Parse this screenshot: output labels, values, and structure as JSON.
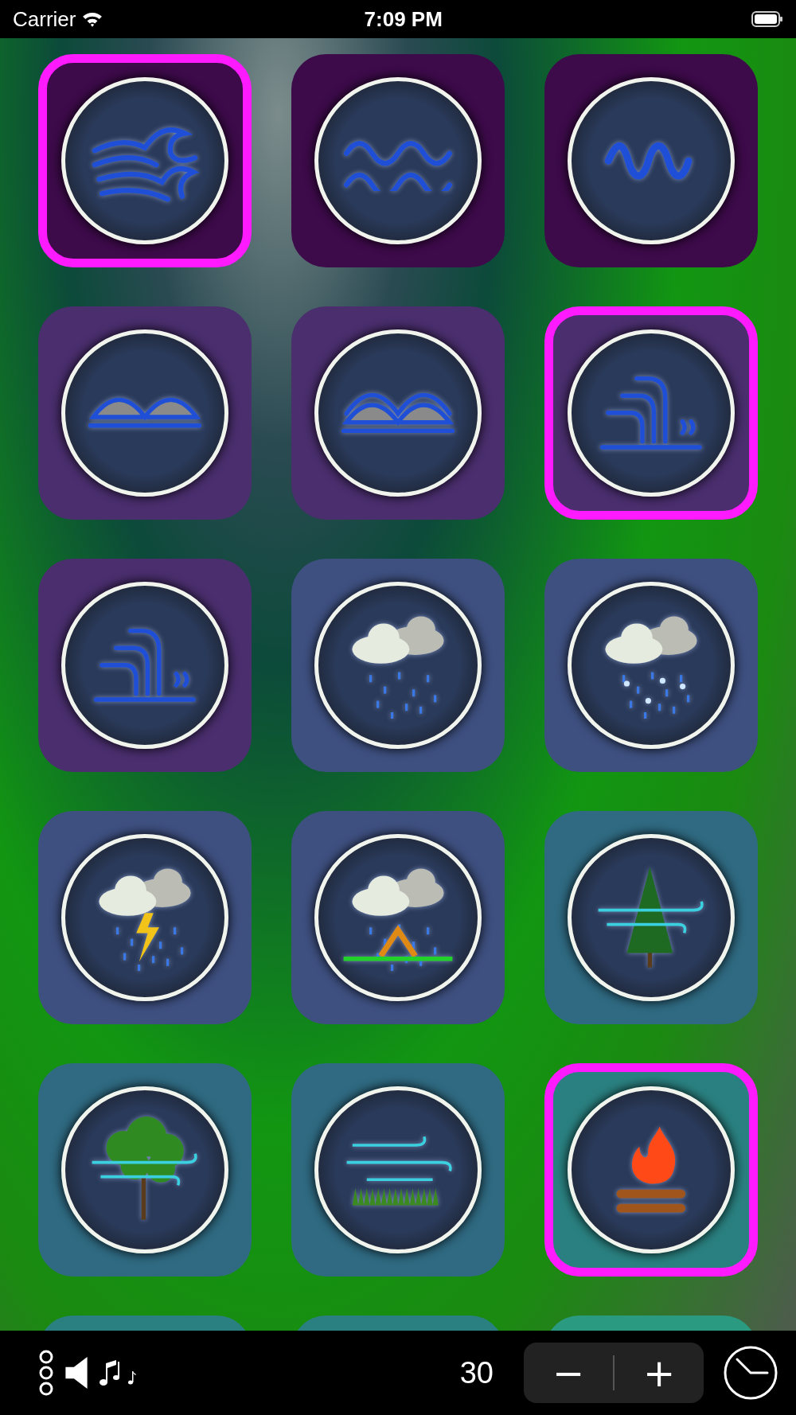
{
  "status_bar": {
    "carrier": "Carrier",
    "time": "7:09 PM"
  },
  "tiles": [
    {
      "selected": true,
      "color": "#3d0a4a"
    },
    {
      "selected": false,
      "color": "#3d0a4a"
    },
    {
      "selected": false,
      "color": "#3d0a4a"
    },
    {
      "selected": false,
      "color": "#4a2e6e"
    },
    {
      "selected": false,
      "color": "#4a2e6e"
    },
    {
      "selected": true,
      "color": "#4a2e6e"
    },
    {
      "selected": false,
      "color": "#4a2e6e"
    },
    {
      "selected": false,
      "color": "#3e5080"
    },
    {
      "selected": false,
      "color": "#3e5080"
    },
    {
      "selected": false,
      "color": "#3e5080"
    },
    {
      "selected": false,
      "color": "#3e5080"
    },
    {
      "selected": false,
      "color": "#2f6a82"
    },
    {
      "selected": false,
      "color": "#2f6a82"
    },
    {
      "selected": false,
      "color": "#2f6a82"
    },
    {
      "selected": true,
      "color": "#2a8080"
    },
    {
      "selected": false,
      "color": "#2a8080"
    },
    {
      "selected": false,
      "color": "#2a8080"
    },
    {
      "selected": false,
      "color": "#2a9a80"
    }
  ],
  "toolbar": {
    "count": "30",
    "minus": "−",
    "plus": "+"
  }
}
